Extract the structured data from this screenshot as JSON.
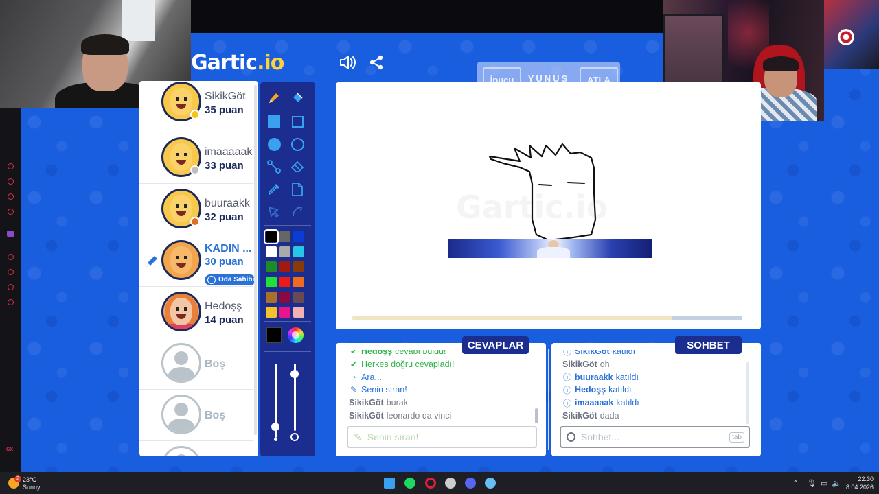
{
  "header": {
    "logo_main": "Gartic",
    "logo_suffix": ".io",
    "sound_icon": "speaker-icon",
    "share_icon": "share-icon",
    "hint_button": "İpucu",
    "word": "YUNUS",
    "skip_button": "ATLA"
  },
  "players": [
    {
      "name": "SikikGöt",
      "score": "35 puan",
      "avatar": "boy",
      "status_color": "#f5c518"
    },
    {
      "name": "imaaaaak",
      "score": "33 puan",
      "avatar": "boy",
      "status_color": "#c0c0c0"
    },
    {
      "name": "buuraakk",
      "score": "32 puan",
      "avatar": "boy",
      "status_color": "#e07020"
    },
    {
      "name": "KADIN ...",
      "score": "30 puan",
      "avatar": "boy-orange",
      "badge": "Oda Sahibi",
      "is_drawing": true
    },
    {
      "name": "Hedoşş",
      "score": "14 puan",
      "avatar": "girl"
    },
    {
      "name": "Boş",
      "avatar": "empty"
    },
    {
      "name": "Boş",
      "avatar": "empty"
    }
  ],
  "toolbar": {
    "tools": [
      "pencil-icon",
      "fill-bucket-icon",
      "filled-rect-icon",
      "outline-rect-icon",
      "filled-circle-icon",
      "outline-circle-icon",
      "line-icon",
      "eraser-icon",
      "eyedropper-icon",
      "blank-page-icon",
      "undo-icon",
      "redo-icon"
    ],
    "colors": [
      "#000000",
      "#666666",
      "#0a3dd6",
      "#ffffff",
      "#aaaaaa",
      "#26c6e8",
      "#1e8a2a",
      "#a01a10",
      "#8a3a0a",
      "#22e03a",
      "#ee1a1a",
      "#f26a1e",
      "#a8702a",
      "#8a0a40",
      "#6a4a52",
      "#f5c12a",
      "#e8168a",
      "#f2b0b0"
    ],
    "selected_color": "#000000",
    "current_color": "#000000",
    "brush_size": 0.15,
    "opacity": 0.85
  },
  "canvas": {
    "watermark": "Gartic.io",
    "progress": 0.82
  },
  "answers": {
    "tab": "CEVAPLAR",
    "messages": [
      {
        "type": "green",
        "icon": "check-icon",
        "user": "Hedoşş",
        "text": "cevabı buldu!"
      },
      {
        "type": "green",
        "icon": "check-icon",
        "user": "",
        "text": "Herkes doğru cevapladı!"
      },
      {
        "type": "blue",
        "icon": "clock-icon",
        "user": "",
        "text": "Ara..."
      },
      {
        "type": "blue",
        "icon": "pencil-icon",
        "user": "",
        "text": "Senin sıran!"
      },
      {
        "type": "plain",
        "icon": "",
        "user": "SikikGöt",
        "text": "burak"
      },
      {
        "type": "plain",
        "icon": "",
        "user": "SikikGöt",
        "text": "leonardo da vinci"
      }
    ],
    "input_placeholder": "Senin sıran!"
  },
  "chat": {
    "tab": "SOHBET",
    "messages": [
      {
        "type": "blue",
        "icon": "info-icon",
        "user": "SikikGöt",
        "text": "katıldı"
      },
      {
        "type": "plain",
        "icon": "",
        "user": "SikikGöt",
        "text": "oh"
      },
      {
        "type": "blue",
        "icon": "info-icon",
        "user": "buuraakk",
        "text": "katıldı"
      },
      {
        "type": "blue",
        "icon": "info-icon",
        "user": "Hedoşş",
        "text": "katıldı"
      },
      {
        "type": "blue",
        "icon": "info-icon",
        "user": "imaaaaak",
        "text": "katıldı"
      },
      {
        "type": "plain",
        "icon": "",
        "user": "SikikGöt",
        "text": "dada"
      }
    ],
    "input_placeholder": "Sohbet...",
    "tab_key": "tab"
  },
  "taskbar": {
    "weather_count": "2",
    "temperature": "23°C",
    "condition": "Sunny",
    "apps": [
      {
        "name": "windows-start-icon",
        "color": "#3aa0f0"
      },
      {
        "name": "spotify-icon",
        "color": "#1ed760"
      },
      {
        "name": "opera-gx-icon",
        "color": "#e0203a"
      },
      {
        "name": "app-icon",
        "color": "#cccccc"
      },
      {
        "name": "discord-icon",
        "color": "#5865f2"
      },
      {
        "name": "steam-icon",
        "color": "#66c0f4"
      }
    ],
    "time": "22:30",
    "date": "8.04.2026"
  }
}
